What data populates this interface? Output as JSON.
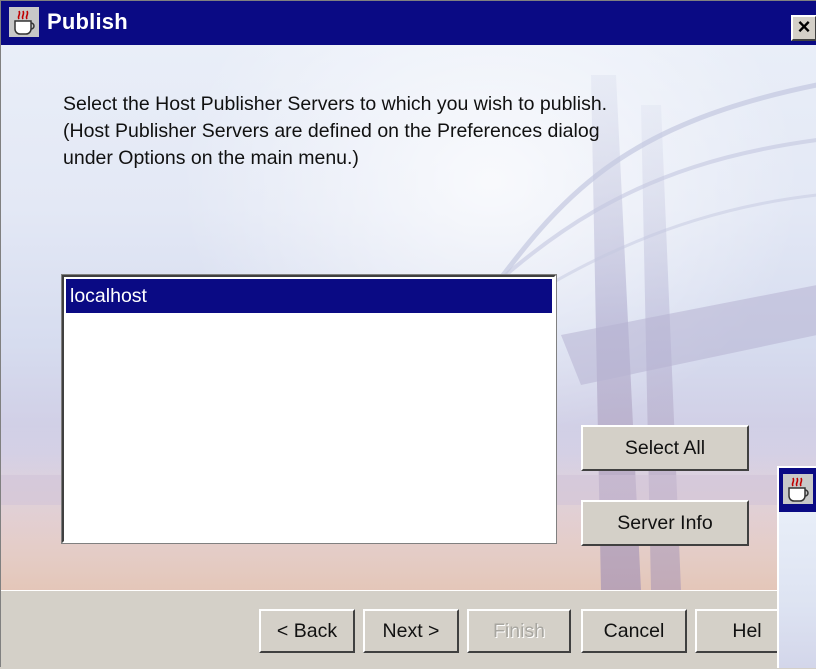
{
  "window": {
    "title": "Publish",
    "close_label": "×"
  },
  "instructions": {
    "text": "Select the Host Publisher Servers to which you wish to publish.\n(Host Publisher Servers are defined on the Preferences dialog\nunder Options on the main menu.)"
  },
  "server_list": {
    "items": [
      {
        "label": "localhost",
        "selected": true
      }
    ]
  },
  "side_buttons": {
    "select_all": "Select All",
    "server_info": "Server Info"
  },
  "footer_buttons": {
    "back": "< Back",
    "next": "Next >",
    "finish": "Finish",
    "cancel": "Cancel",
    "help": "Hel"
  },
  "icons": {
    "app_icon": "coffee-cup-icon",
    "close_icon": "close-icon"
  },
  "colors": {
    "titlebar": "#0a0a84",
    "selection": "#0a0a84",
    "face": "#d4d0c8"
  }
}
